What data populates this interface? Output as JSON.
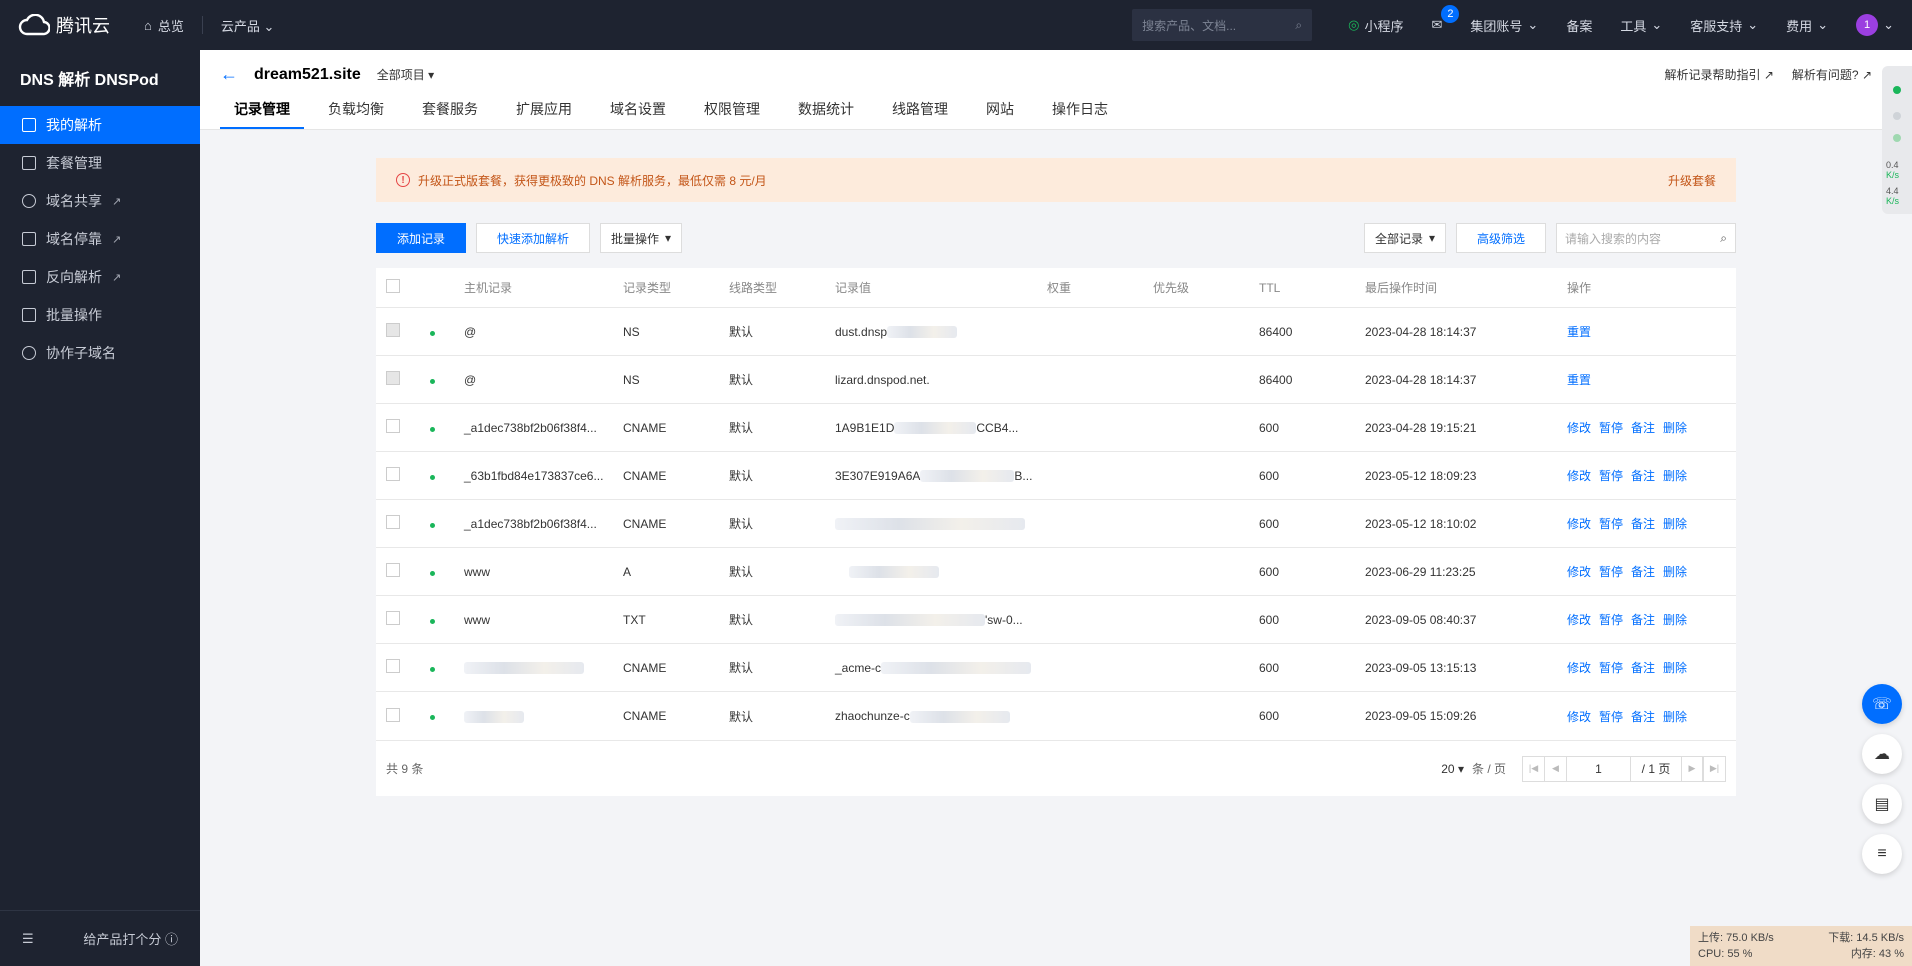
{
  "topbar": {
    "logo": "腾讯云",
    "home": "总览",
    "products": "云产品",
    "search_placeholder": "搜索产品、文档...",
    "mini_program": "小程序",
    "mail_badge": "2",
    "group_account": "集团账号",
    "beian": "备案",
    "tools": "工具",
    "support": "客服支持",
    "fees": "费用",
    "avatar": "1"
  },
  "sidebar": {
    "title": "DNS 解析 DNSPod",
    "items": [
      {
        "label": "我的解析"
      },
      {
        "label": "套餐管理"
      },
      {
        "label": "域名共享"
      },
      {
        "label": "域名停靠"
      },
      {
        "label": "反向解析"
      },
      {
        "label": "批量操作"
      },
      {
        "label": "协作子域名"
      }
    ],
    "feedback": "给产品打个分"
  },
  "header": {
    "domain": "dream521.site",
    "project": "全部项目",
    "help_link": "解析记录帮助指引",
    "problem_link": "解析有问题?",
    "tabs": [
      "记录管理",
      "负载均衡",
      "套餐服务",
      "扩展应用",
      "域名设置",
      "权限管理",
      "数据统计",
      "线路管理",
      "网站",
      "操作日志"
    ]
  },
  "notice": {
    "text": "升级正式版套餐，获得更极致的 DNS 解析服务，最低仅需 8 元/月",
    "action": "升级套餐"
  },
  "toolbar": {
    "add": "添加记录",
    "quick_add": "快速添加解析",
    "batch": "批量操作",
    "filter_select": "全部记录",
    "advanced": "高级筛选",
    "search_placeholder": "请输入搜索的内容"
  },
  "table": {
    "headers": {
      "host": "主机记录",
      "type": "记录类型",
      "line": "线路类型",
      "value": "记录值",
      "weight": "权重",
      "priority": "优先级",
      "ttl": "TTL",
      "time": "最后操作时间",
      "ops": "操作"
    },
    "rows": [
      {
        "host": "@",
        "type": "NS",
        "line": "默认",
        "value": "dust.dnsp",
        "ttl": "86400",
        "time": "2023-04-28 18:14:37",
        "ops": [
          "重置"
        ]
      },
      {
        "host": "@",
        "type": "NS",
        "line": "默认",
        "value": "lizard.dnspod.net.",
        "ttl": "86400",
        "time": "2023-04-28 18:14:37",
        "ops": [
          "重置"
        ]
      },
      {
        "host": "_a1dec738bf2b06f38f4...",
        "type": "CNAME",
        "line": "默认",
        "value": "1A9B1E1D",
        "value_tail": "CCB4...",
        "ttl": "600",
        "time": "2023-04-28 19:15:21",
        "ops": [
          "修改",
          "暂停",
          "备注",
          "删除"
        ]
      },
      {
        "host": "_63b1fbd84e173837ce6...",
        "type": "CNAME",
        "line": "默认",
        "value": "3E307E919A6A",
        "value_tail": "B...",
        "ttl": "600",
        "time": "2023-05-12 18:09:23",
        "ops": [
          "修改",
          "暂停",
          "备注",
          "删除"
        ]
      },
      {
        "host": "_a1dec738bf2b06f38f4...",
        "type": "CNAME",
        "line": "默认",
        "value": "",
        "ttl": "600",
        "time": "2023-05-12 18:10:02",
        "ops": [
          "修改",
          "暂停",
          "备注",
          "删除"
        ]
      },
      {
        "host": "www",
        "type": "A",
        "line": "默认",
        "value": "",
        "ttl": "600",
        "time": "2023-06-29 11:23:25",
        "ops": [
          "修改",
          "暂停",
          "备注",
          "删除"
        ]
      },
      {
        "host": "www",
        "type": "TXT",
        "line": "默认",
        "value": "",
        "value_tail": "'sw-0...",
        "ttl": "600",
        "time": "2023-09-05 08:40:37",
        "ops": [
          "修改",
          "暂停",
          "备注",
          "删除"
        ]
      },
      {
        "host": "",
        "type": "CNAME",
        "line": "默认",
        "value": "_acme-c",
        "ttl": "600",
        "time": "2023-09-05 13:15:13",
        "ops": [
          "修改",
          "暂停",
          "备注",
          "删除"
        ]
      },
      {
        "host": "",
        "type": "CNAME",
        "line": "默认",
        "value": "zhaochunze-c",
        "ttl": "600",
        "time": "2023-09-05 15:09:26",
        "ops": [
          "修改",
          "暂停",
          "备注",
          "删除"
        ]
      }
    ]
  },
  "pager": {
    "total": "共 9 条",
    "page_size": "20",
    "per_page": "条 / 页",
    "current": "1",
    "total_pages": "/ 1 页"
  },
  "right_widget": {
    "up_speed": "0.4",
    "down_speed": "4.4",
    "unit": "K/s"
  },
  "netmon": {
    "upload": "上传: 75.0 KB/s",
    "download": "下载: 14.5 KB/s",
    "cpu": "CPU: 55 %",
    "mem": "内存: 43 %"
  },
  "colors": {
    "accent": "#006eff",
    "nav_bg": "#1e2330",
    "notice_bg": "#fdebdc",
    "status_green": "#1ab65a"
  }
}
